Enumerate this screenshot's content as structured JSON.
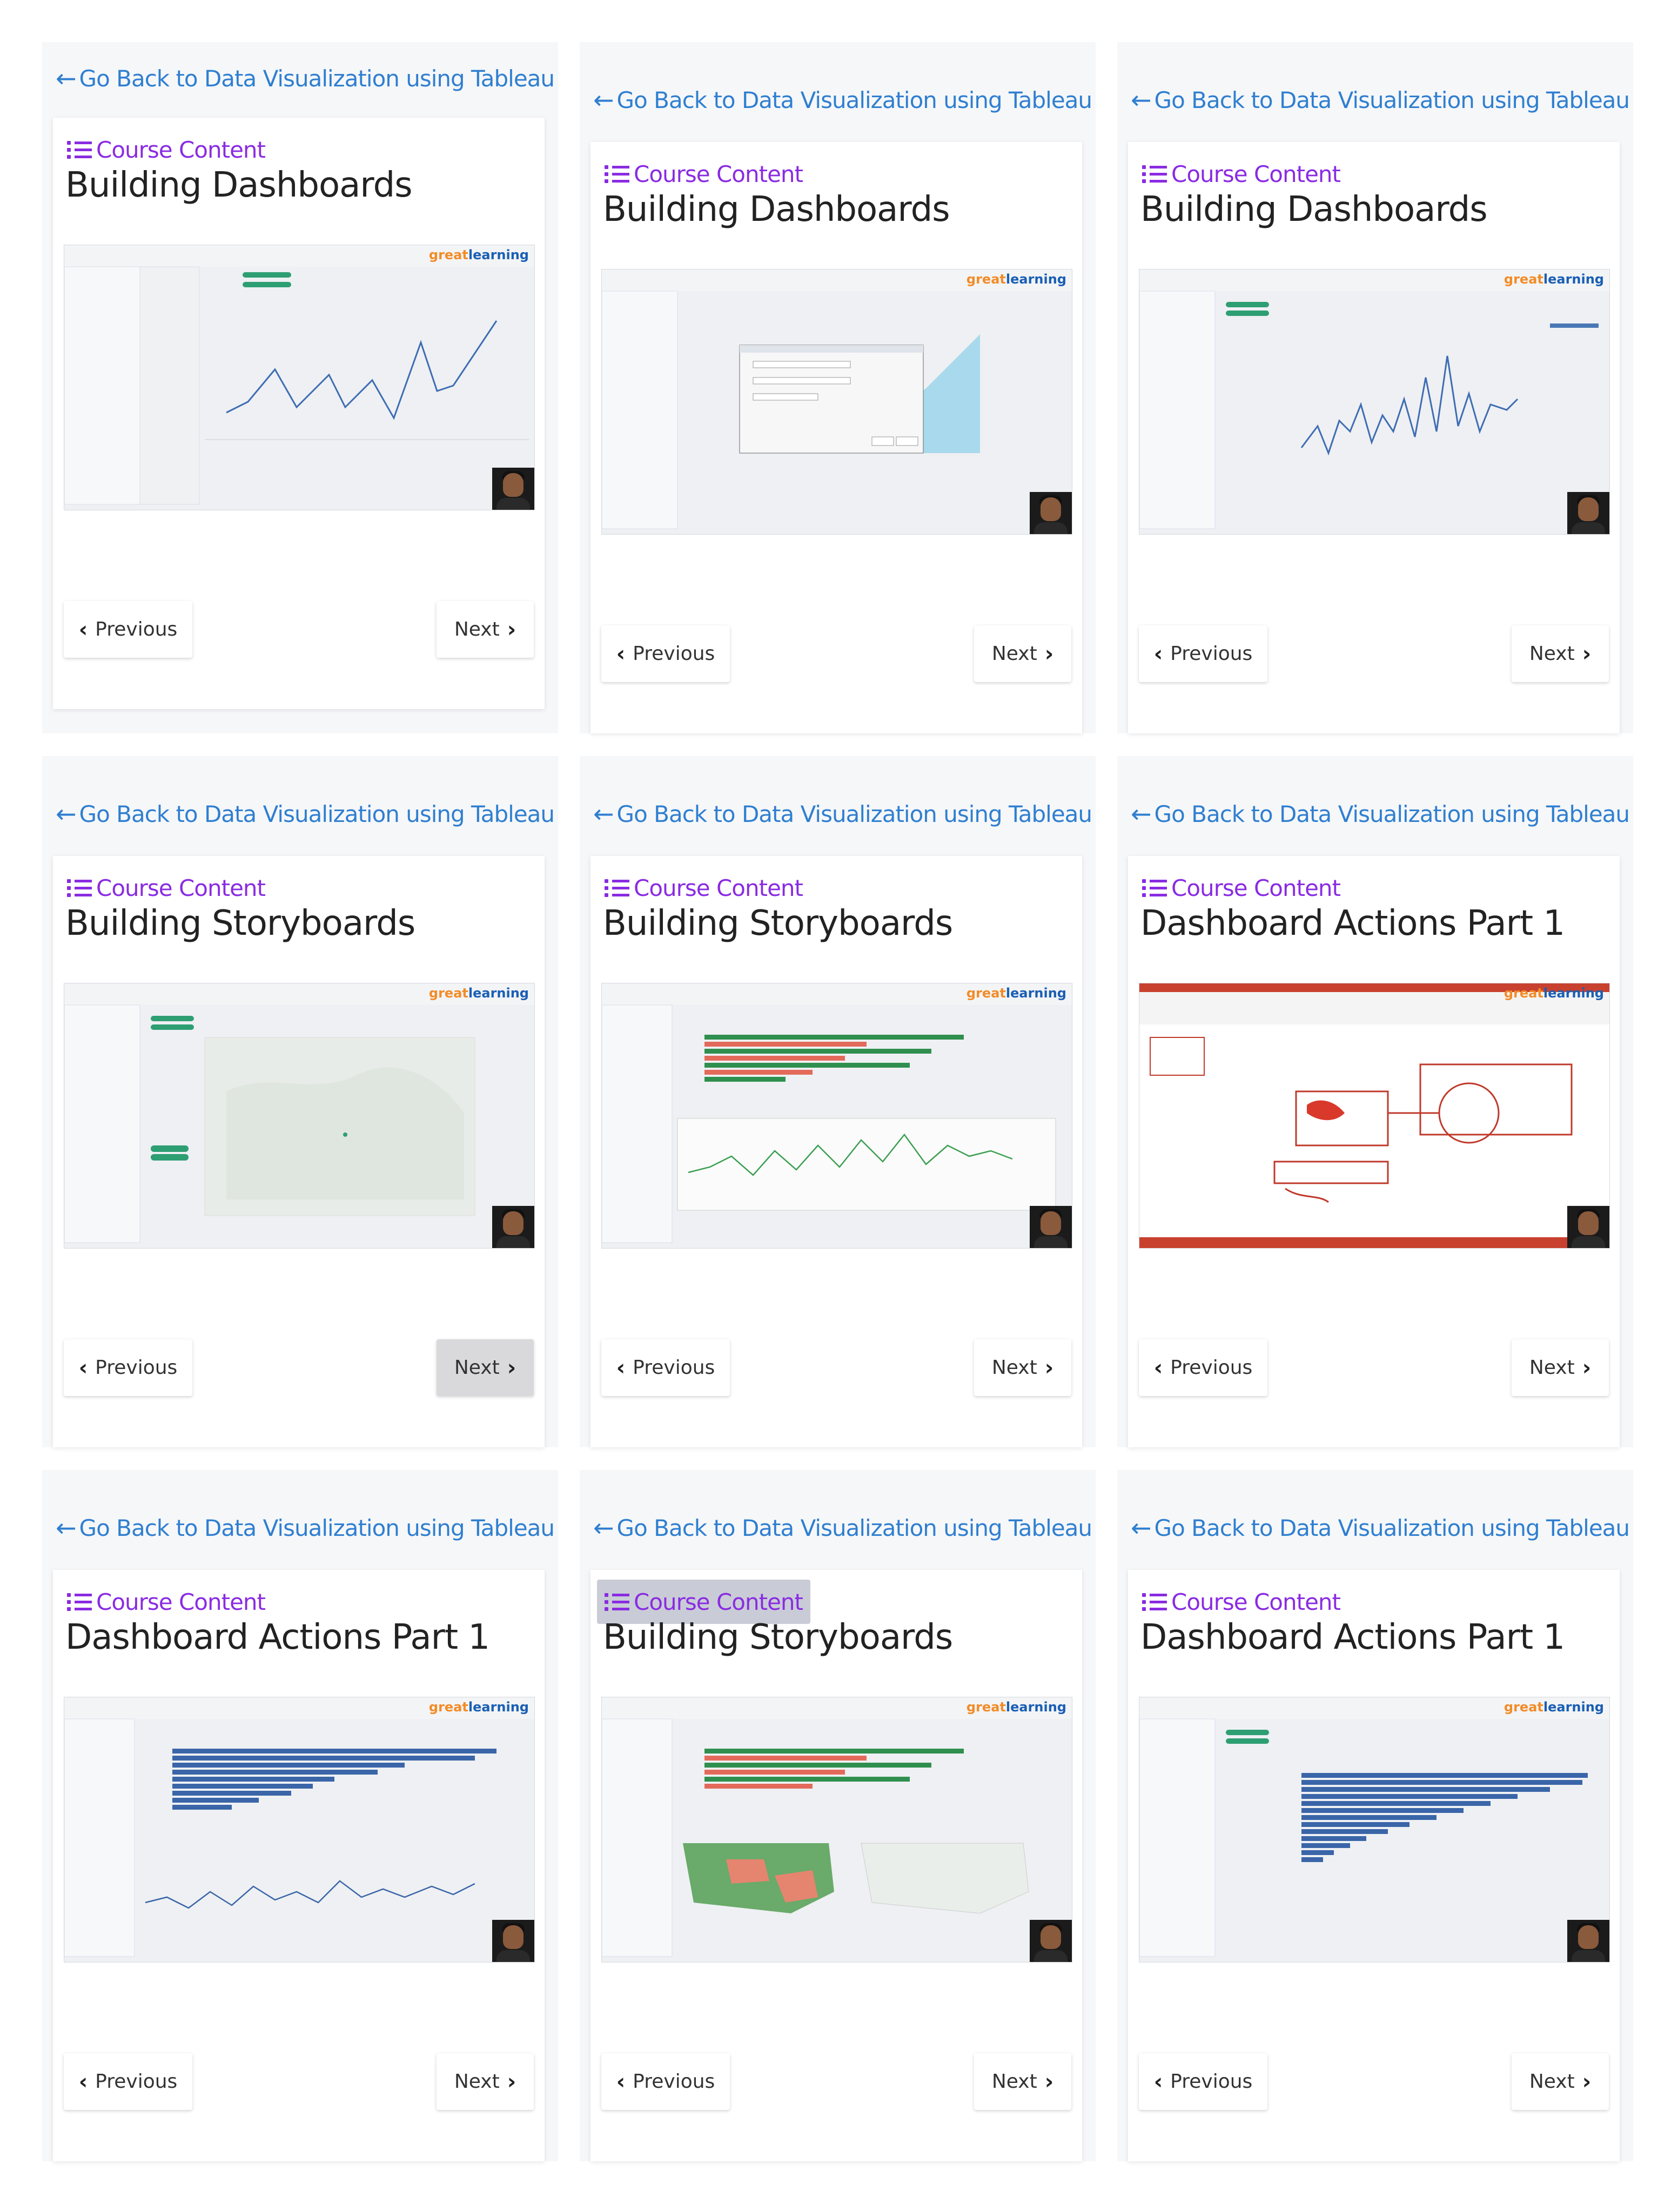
{
  "panels": [
    {
      "back": "Go Back to Data Visualization using Tableau",
      "course": "Course Content",
      "title": "Building Dashboards",
      "prev": "Previous",
      "next": "Next"
    },
    {
      "back": "Go Back to Data Visualization using Tableau",
      "course": "Course Content",
      "title": "Building Dashboards",
      "prev": "Previous",
      "next": "Next"
    },
    {
      "back": "Go Back to Data Visualization using Tableau",
      "course": "Course Content",
      "title": "Building Dashboards",
      "prev": "Previous",
      "next": "Next"
    },
    {
      "back": "Go Back to Data Visualization using Tableau",
      "course": "Course Content",
      "title": "Building Storyboards",
      "prev": "Previous",
      "next": "Next"
    },
    {
      "back": "Go Back to Data Visualization using Tableau",
      "course": "Course Content",
      "title": "Building Storyboards",
      "prev": "Previous",
      "next": "Next"
    },
    {
      "back": "Go Back to Data Visualization using Tableau",
      "course": "Course Content",
      "title": "Dashboard Actions Part 1",
      "prev": "Previous",
      "next": "Next"
    },
    {
      "back": "Go Back to Data Visualization using Tableau",
      "course": "Course Content",
      "title": "Dashboard Actions Part 1",
      "prev": "Previous",
      "next": "Next"
    },
    {
      "back": "Go Back to Data Visualization using Tableau",
      "course": "Course Content",
      "title": "Building Storyboards",
      "prev": "Previous",
      "next": "Next"
    },
    {
      "back": "Go Back to Data Visualization using Tableau",
      "course": "Course Content",
      "title": "Dashboard Actions Part 1",
      "prev": "Previous",
      "next": "Next"
    }
  ],
  "brand": {
    "part1": "great",
    "part2": "learning"
  },
  "colors": {
    "link": "#2f7fd0",
    "course": "#8a2be2",
    "title": "#222222"
  }
}
